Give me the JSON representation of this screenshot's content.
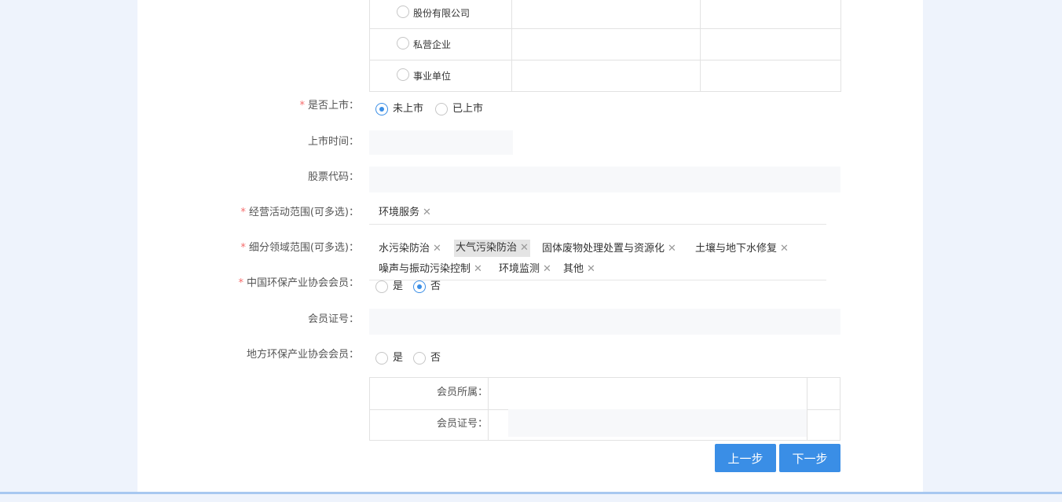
{
  "company_types": [
    "股份有限公司",
    "私营企业",
    "事业单位"
  ],
  "listed": {
    "label": "是否上市：",
    "options": [
      "未上市",
      "已上市"
    ],
    "selected": 0
  },
  "listing_time": {
    "label": "上市时间：",
    "value": ""
  },
  "stock_code": {
    "label": "股票代码：",
    "value": ""
  },
  "business_scope": {
    "label": "经营活动范围(可多选)：",
    "tags": [
      "环境服务"
    ]
  },
  "sub_fields": {
    "label": "细分领域范围(可多选)：",
    "tags": [
      "水污染防治",
      "大气污染防治",
      "固体废物处理处置与资源化",
      "土壤与地下水修复",
      "噪声与振动污染控制",
      "环境监测",
      "其他"
    ],
    "highlighted": "大气污染防治"
  },
  "china_member": {
    "label": "中国环保产业协会会员：",
    "options": [
      "是",
      "否"
    ],
    "selected": 1
  },
  "member_no": {
    "label": "会员证号：",
    "value": ""
  },
  "local_member": {
    "label": "地方环保产业协会会员：",
    "options": [
      "是",
      "否"
    ],
    "selected": null
  },
  "member_table": {
    "belong_label": "会员所属：",
    "cert_label": "会员证号："
  },
  "buttons": {
    "prev": "上一步",
    "next": "下一步"
  },
  "icons": {
    "remove_tag": "close-icon"
  },
  "colors": {
    "primary": "#3a8ee6",
    "required": "#f56c6c"
  }
}
